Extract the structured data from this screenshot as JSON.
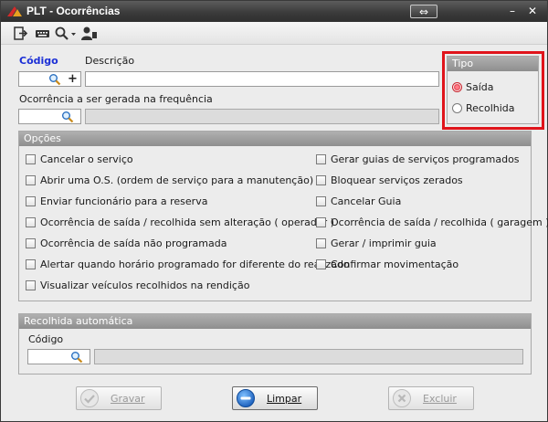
{
  "window": {
    "title": "PLT - Ocorrências",
    "restore_glyph": "⇔",
    "minimize_glyph": "–",
    "close_glyph": "✕"
  },
  "toolbar": {
    "items": [
      {
        "name": "exit-icon"
      },
      {
        "name": "keyboard-icon"
      },
      {
        "name": "search-dropdown-icon"
      },
      {
        "name": "user-icon"
      }
    ]
  },
  "form": {
    "codigo_label": "Código",
    "codigo_value": "",
    "plus_glyph": "+",
    "descricao_label": "Descrição",
    "descricao_value": "",
    "ocorrencia_label": "Ocorrência a ser gerada na frequência",
    "ocorrencia_value": "",
    "ocorrencia_desc_value": ""
  },
  "tipo": {
    "title": "Tipo",
    "options": [
      {
        "label": "Saída",
        "checked": true
      },
      {
        "label": "Recolhida",
        "checked": false
      }
    ]
  },
  "opcoes": {
    "title": "Opções",
    "left": [
      "Cancelar o serviço",
      "Abrir uma O.S. (ordem de serviço para a manutenção)",
      "Enviar funcionário para a reserva",
      "Ocorrência de saída / recolhida sem alteração ( operador )",
      "Ocorrência de saída não programada",
      "Alertar quando horário programado for diferente do realizado",
      "Visualizar veículos recolhidos na rendição"
    ],
    "right": [
      "Gerar guias de serviços programados",
      "Bloquear serviços zerados",
      "Cancelar Guia",
      "Ocorrência de saída / recolhida ( garagem )",
      "Gerar / imprimir guia",
      "Confirmar movimentação"
    ]
  },
  "recolhida": {
    "title": "Recolhida automática",
    "codigo_label": "Código",
    "codigo_value": "",
    "desc_value": ""
  },
  "buttons": {
    "gravar": "Gravar",
    "limpar": "Limpar",
    "excluir": "Excluir"
  },
  "colors": {
    "highlight": "#e0141b",
    "link_label": "#1b2fd6",
    "primary_button_icon": "#1f6fd1"
  }
}
